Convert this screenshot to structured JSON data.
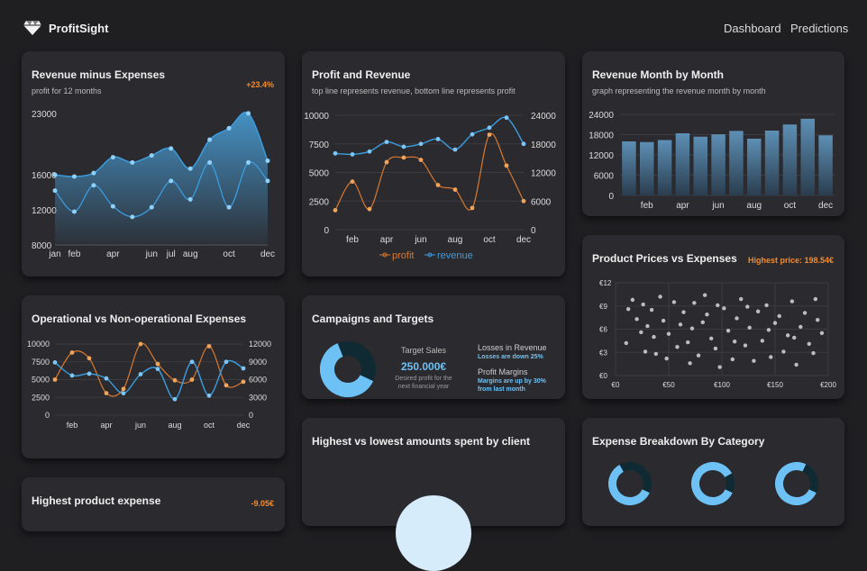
{
  "app": {
    "name": "ProfitSight"
  },
  "nav": [
    {
      "label": "Dashboard"
    },
    {
      "label": "Predictions"
    }
  ],
  "colors": {
    "background": "#1f1f22",
    "card": "#2b2b2f",
    "blue": "#3a9de0",
    "orange": "#d9782e",
    "accent_orange": "#f48a2c",
    "light_blue": "#6ec1f5",
    "dark_teal": "#0f2a33"
  },
  "cards": {
    "rev_minus_exp": {
      "title": "Revenue minus Expenses",
      "subtitle": "profit for 12 months",
      "badge": "+23.4%"
    },
    "profit_revenue": {
      "title": "Profit and Revenue",
      "subtitle": "top line represents revenue, bottom line represents profit"
    },
    "rev_month": {
      "title": "Revenue Month by Month",
      "subtitle": "graph representing the revenue month by month"
    },
    "op_nonop": {
      "title": "Operational vs Non-operational Expenses"
    },
    "campaigns": {
      "title": "Campaigns and Targets",
      "target_label": "Target Sales",
      "target_value": "250.000€",
      "target_desc_1": "Desired profit for the",
      "target_desc_2": "next financial year",
      "losses_label": "Losses in Revenue",
      "losses_note": "Losses are down 25%",
      "margins_label": "Profit Margins",
      "margins_note_1": "Margins are up by 30%",
      "margins_note_2": "from last month",
      "donut_fraction": 0.62
    },
    "prices": {
      "title": "Product Prices vs Expenses",
      "badge": "Highest price: 198.54€"
    },
    "highest_lowest": {
      "title": "Highest vs lowest amounts spent by client"
    },
    "expense_breakdown": {
      "title": "Expense Breakdown By Category",
      "donut_fractions": [
        0.6,
        0.85,
        0.75
      ]
    },
    "highest_product": {
      "title": "Highest product expense",
      "badge": "-9.05€"
    }
  },
  "chart_data": [
    {
      "id": "rev_minus_exp",
      "type": "area",
      "x": [
        "jan",
        "feb",
        "mar",
        "apr",
        "may",
        "jun",
        "jul",
        "aug",
        "sep",
        "oct",
        "nov",
        "dec"
      ],
      "x_tick_labels": [
        "jan",
        "feb",
        "apr",
        "jun",
        "jul",
        "aug",
        "oct",
        "dec"
      ],
      "series": [
        {
          "values": [
            16000,
            15800,
            16200,
            18000,
            17400,
            18200,
            19000,
            16700,
            20000,
            21300,
            23000,
            17600
          ]
        },
        {
          "values": [
            14200,
            11800,
            14800,
            12400,
            11200,
            12300,
            15300,
            13200,
            17400,
            12300,
            17400,
            15300
          ]
        }
      ],
      "yticks": [
        8000,
        12000,
        16000,
        23000
      ],
      "ylim": [
        8000,
        23500
      ]
    },
    {
      "id": "profit_revenue",
      "type": "line",
      "x": [
        "jan",
        "feb",
        "mar",
        "apr",
        "may",
        "jun",
        "jul",
        "aug",
        "sep",
        "oct",
        "nov",
        "dec"
      ],
      "x_tick_labels": [
        "feb",
        "apr",
        "jun",
        "aug",
        "oct",
        "dec"
      ],
      "series": [
        {
          "name": "profit",
          "axis": "left",
          "values": [
            1700,
            4200,
            1800,
            5900,
            6300,
            6100,
            3900,
            3500,
            1900,
            8300,
            5600,
            2500
          ]
        },
        {
          "name": "revenue",
          "axis": "right",
          "values": [
            16000,
            15800,
            16400,
            18400,
            17400,
            18000,
            19000,
            16800,
            20000,
            21400,
            23500,
            18000
          ]
        }
      ],
      "yticks_left": [
        0,
        2500,
        5000,
        7500,
        10000
      ],
      "yticks_right": [
        0,
        6000,
        12000,
        18000,
        24000
      ],
      "ylim_left": [
        0,
        10000
      ],
      "ylim_right": [
        0,
        24000
      ],
      "legend": "bottom"
    },
    {
      "id": "rev_month",
      "type": "bar",
      "categories": [
        "jan",
        "feb",
        "mar",
        "apr",
        "may",
        "jun",
        "jul",
        "aug",
        "sep",
        "oct",
        "nov",
        "dec"
      ],
      "x_tick_labels": [
        "feb",
        "apr",
        "jun",
        "aug",
        "oct",
        "dec"
      ],
      "values": [
        16000,
        15800,
        16400,
        18400,
        17400,
        18100,
        19100,
        16800,
        19200,
        21000,
        22700,
        17800
      ],
      "yticks": [
        0,
        6000,
        12000,
        18000,
        24000
      ],
      "ylim": [
        0,
        24000
      ],
      "grid": true
    },
    {
      "id": "op_nonop",
      "type": "line",
      "x": [
        "jan",
        "feb",
        "mar",
        "apr",
        "may",
        "jun",
        "jul",
        "aug",
        "sep",
        "oct",
        "nov",
        "dec"
      ],
      "x_tick_labels": [
        "feb",
        "apr",
        "jun",
        "aug",
        "oct",
        "dec"
      ],
      "series": [
        {
          "axis": "left",
          "values": [
            5000,
            8800,
            8000,
            3100,
            3700,
            10000,
            7200,
            4900,
            5000,
            9700,
            4200,
            4700
          ]
        },
        {
          "axis": "right",
          "values": [
            8900,
            6700,
            7000,
            6200,
            3700,
            6900,
            7800,
            2700,
            9000,
            3300,
            9000,
            7900
          ]
        }
      ],
      "yticks_left": [
        0,
        2500,
        5000,
        7500,
        10000
      ],
      "yticks_right": [
        0,
        3000,
        6000,
        9000,
        12000
      ],
      "ylim_left": [
        0,
        10000
      ],
      "ylim_right": [
        0,
        12000
      ]
    },
    {
      "id": "prices",
      "type": "scatter",
      "xticks": [
        "€0",
        "€50",
        "€100",
        "€150",
        "€200"
      ],
      "yticks": [
        "€0",
        "€3",
        "€6",
        "€9",
        "€12"
      ],
      "xlim": [
        0,
        200
      ],
      "ylim": [
        0,
        12
      ],
      "points": [
        [
          12,
          8.6
        ],
        [
          16,
          9.8
        ],
        [
          20,
          7.3
        ],
        [
          24,
          5.6
        ],
        [
          26,
          9.2
        ],
        [
          30,
          6.4
        ],
        [
          34,
          8.5
        ],
        [
          38,
          2.8
        ],
        [
          42,
          10.2
        ],
        [
          45,
          7.1
        ],
        [
          50,
          5.4
        ],
        [
          55,
          9.5
        ],
        [
          58,
          3.7
        ],
        [
          61,
          6.6
        ],
        [
          64,
          8.2
        ],
        [
          68,
          4.3
        ],
        [
          70,
          1.6
        ],
        [
          74,
          9.4
        ],
        [
          78,
          2.6
        ],
        [
          82,
          6.9
        ],
        [
          86,
          7.9
        ],
        [
          90,
          4.8
        ],
        [
          94,
          3.5
        ],
        [
          98,
          1.1
        ],
        [
          102,
          8.7
        ],
        [
          106,
          5.8
        ],
        [
          110,
          2.1
        ],
        [
          114,
          7.4
        ],
        [
          118,
          9.9
        ],
        [
          122,
          3.9
        ],
        [
          126,
          6.2
        ],
        [
          130,
          1.9
        ],
        [
          134,
          8.3
        ],
        [
          138,
          4.5
        ],
        [
          142,
          9.1
        ],
        [
          146,
          2.4
        ],
        [
          150,
          6.8
        ],
        [
          154,
          7.7
        ],
        [
          158,
          3.1
        ],
        [
          162,
          5.2
        ],
        [
          166,
          9.6
        ],
        [
          170,
          1.4
        ],
        [
          174,
          6.3
        ],
        [
          178,
          8.1
        ],
        [
          182,
          4.1
        ],
        [
          186,
          2.9
        ],
        [
          190,
          7.2
        ],
        [
          194,
          5.5
        ],
        [
          36,
          5.0
        ],
        [
          84,
          10.4
        ],
        [
          124,
          8.9
        ],
        [
          168,
          4.9
        ],
        [
          10,
          4.2
        ],
        [
          48,
          2.2
        ],
        [
          96,
          9.1
        ],
        [
          144,
          5.9
        ],
        [
          188,
          9.9
        ],
        [
          72,
          6.1
        ],
        [
          28,
          3.1
        ],
        [
          112,
          4.4
        ]
      ]
    }
  ]
}
